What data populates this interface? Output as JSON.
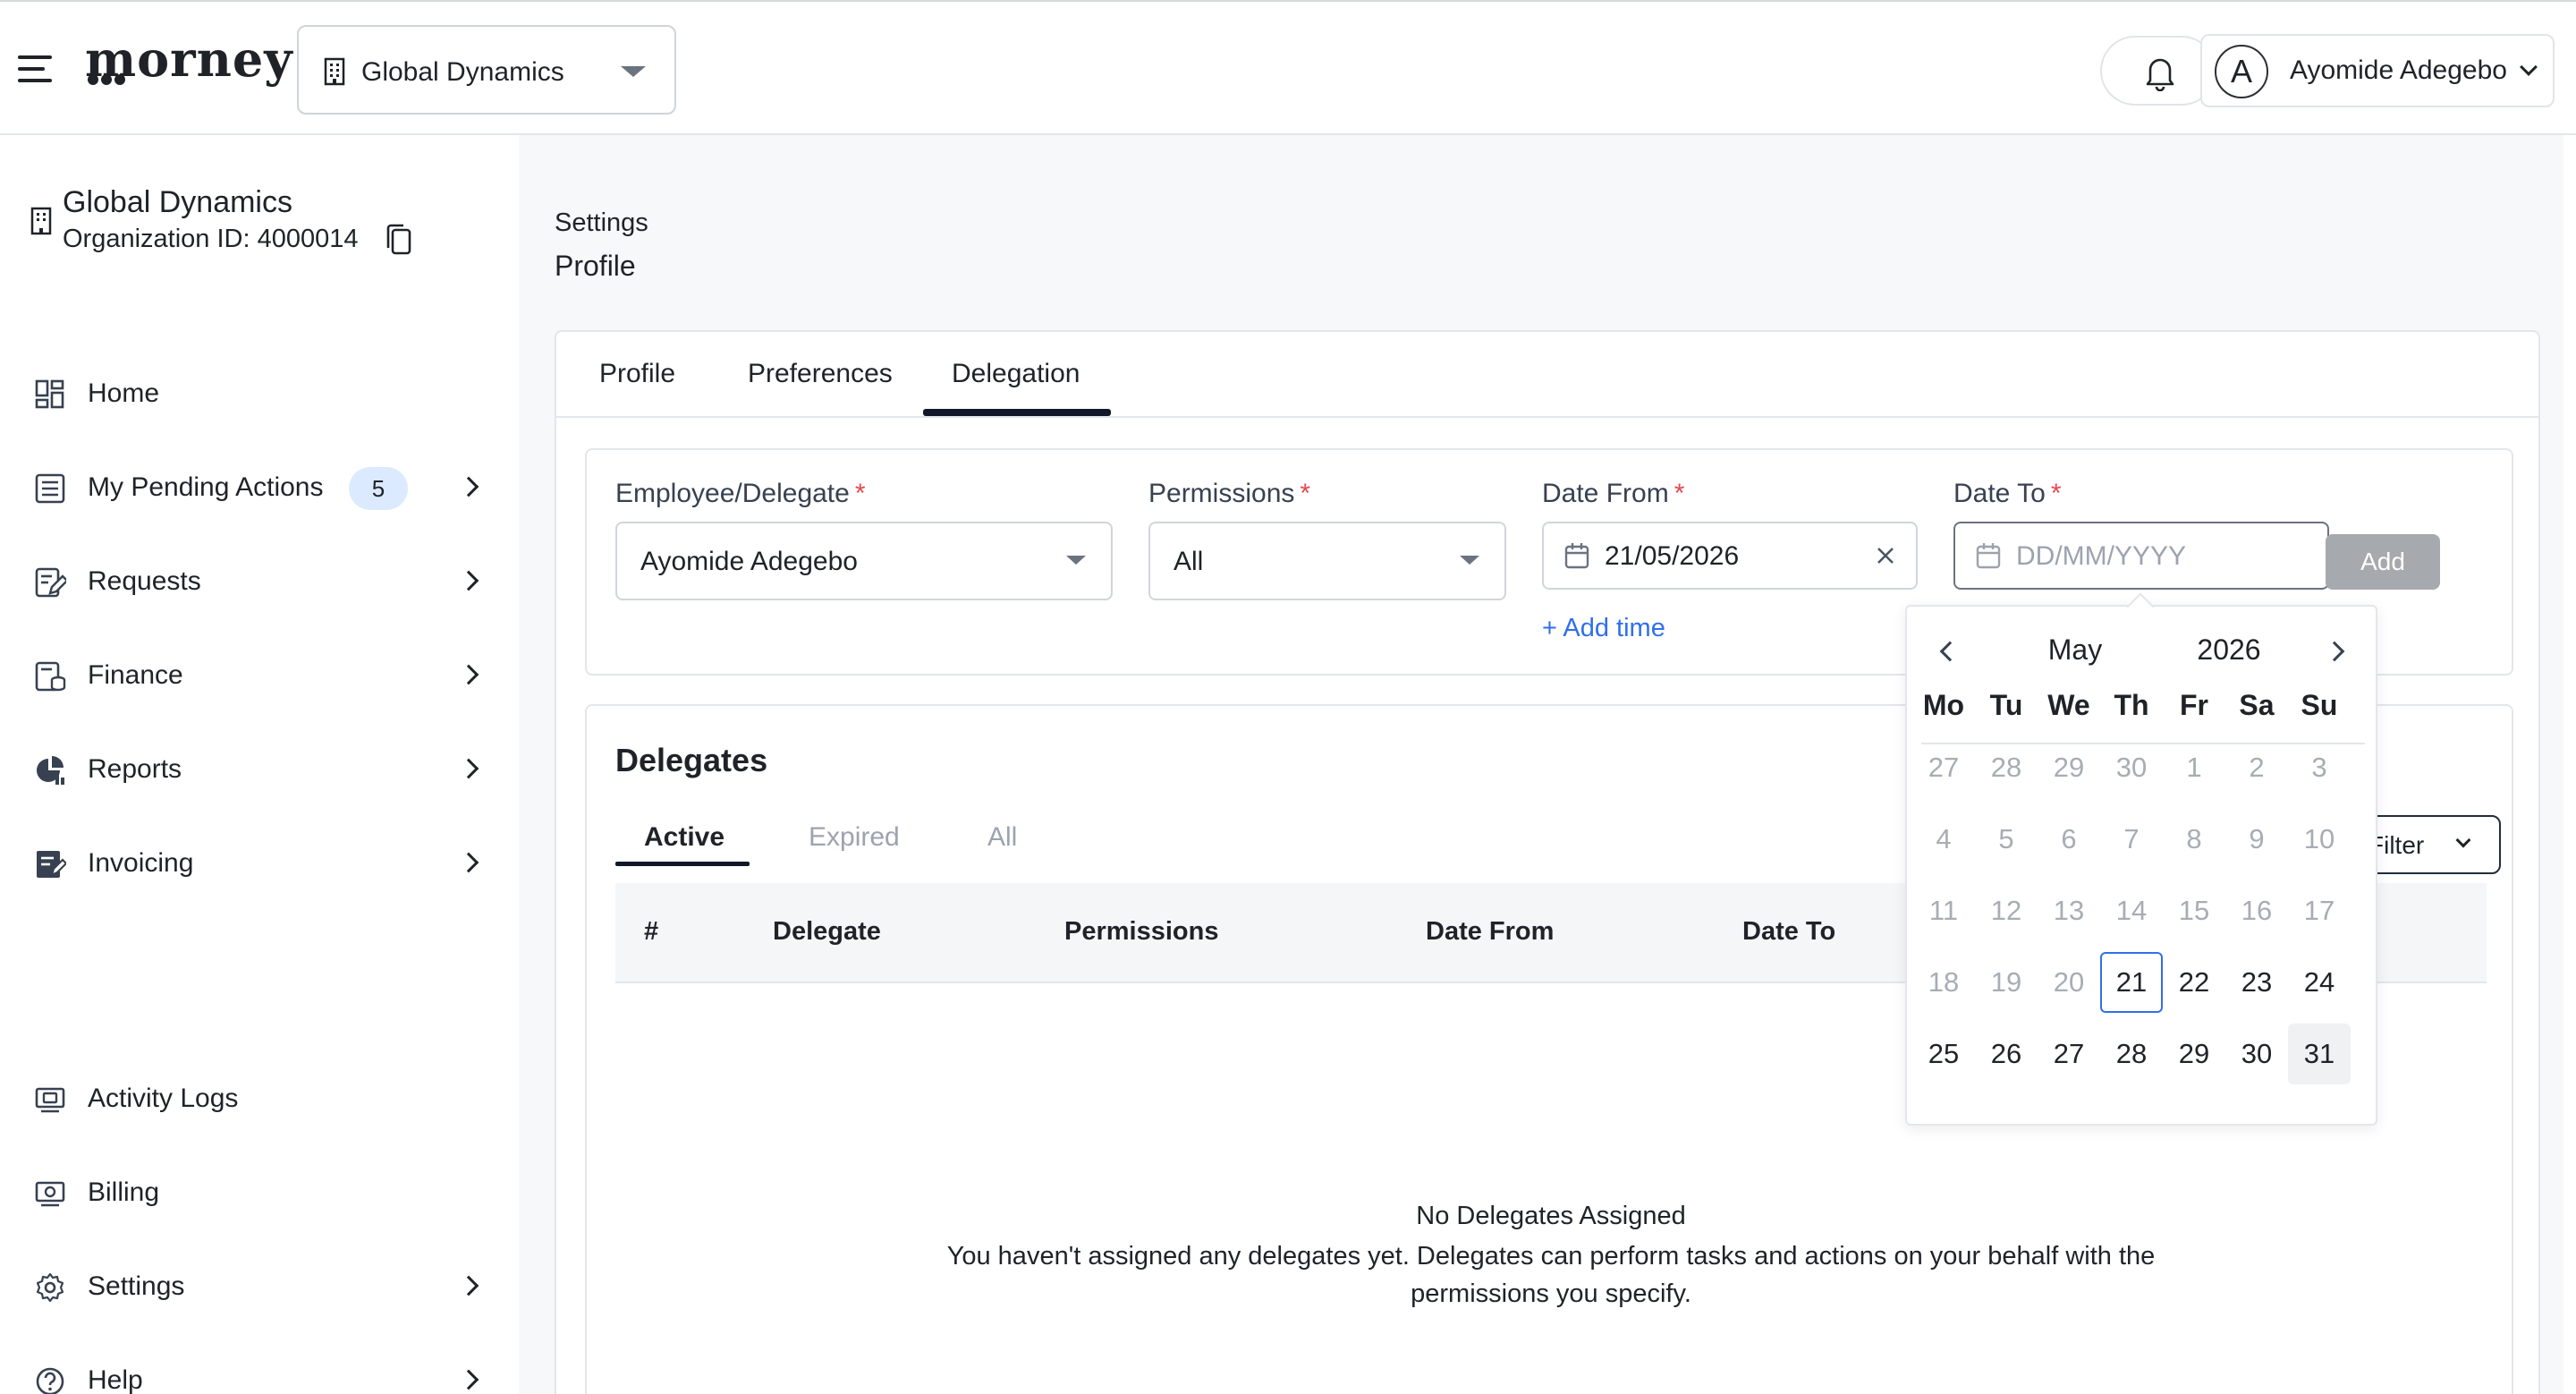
{
  "app": {
    "logo": "morney"
  },
  "header": {
    "org_selector": "Global Dynamics",
    "user_initial": "A",
    "user_name": "Ayomide Adegebo"
  },
  "sidebar": {
    "org_name": "Global Dynamics",
    "org_id": "Organization ID: 4000014",
    "items": [
      {
        "label": "Home",
        "icon": "home-grid-icon"
      },
      {
        "label": "My Pending Actions",
        "icon": "list-icon",
        "badge": "5"
      },
      {
        "label": "Requests",
        "icon": "edit-doc-icon"
      },
      {
        "label": "Finance",
        "icon": "finance-icon"
      },
      {
        "label": "Reports",
        "icon": "pie-chart-icon"
      },
      {
        "label": "Invoicing",
        "icon": "invoice-icon"
      },
      {
        "label": "Activity Logs",
        "icon": "monitor-icon"
      },
      {
        "label": "Billing",
        "icon": "billing-icon"
      },
      {
        "label": "Settings",
        "icon": "gear-icon"
      },
      {
        "label": "Help",
        "icon": "help-icon"
      }
    ]
  },
  "page": {
    "breadcrumb": "Settings",
    "title": "Profile",
    "tabs": [
      "Profile",
      "Preferences",
      "Delegation"
    ],
    "active_tab": "Delegation"
  },
  "form": {
    "employee_label": "Employee/Delegate",
    "employee_value": "Ayomide Adegebo",
    "permissions_label": "Permissions",
    "permissions_value": "All",
    "date_from_label": "Date From",
    "date_from_value": "21/05/2026",
    "date_to_label": "Date To",
    "date_to_placeholder": "DD/MM/YYYY",
    "required_mark": "*",
    "add_time": "+ Add time",
    "add_button": "Add"
  },
  "delegates": {
    "title": "Delegates",
    "subtabs": [
      "Active",
      "Expired",
      "All"
    ],
    "filter_label": "Filter",
    "columns": [
      "#",
      "Delegate",
      "Permissions",
      "Date From",
      "Date To"
    ],
    "empty_title": "No Delegates Assigned",
    "empty_text": "You haven't assigned any delegates yet. Delegates can perform tasks and actions on your behalf with the permissions you specify."
  },
  "calendar": {
    "month": "May",
    "year": "2026",
    "weekdays": [
      "Mo",
      "Tu",
      "We",
      "Th",
      "Fr",
      "Sa",
      "Su"
    ],
    "weeks": [
      [
        "27",
        "28",
        "29",
        "30",
        "1",
        "2",
        "3"
      ],
      [
        "4",
        "5",
        "6",
        "7",
        "8",
        "9",
        "10"
      ],
      [
        "11",
        "12",
        "13",
        "14",
        "15",
        "16",
        "17"
      ],
      [
        "18",
        "19",
        "20",
        "21",
        "22",
        "23",
        "24"
      ],
      [
        "25",
        "26",
        "27",
        "28",
        "29",
        "30",
        "31"
      ]
    ],
    "selected_day": "21",
    "hovered_day": "31"
  },
  "colors": {
    "accent": "#2f6feb",
    "required": "#e5484d",
    "badge_bg": "#dbeafe",
    "disabled_button": "#a6a9ad"
  }
}
